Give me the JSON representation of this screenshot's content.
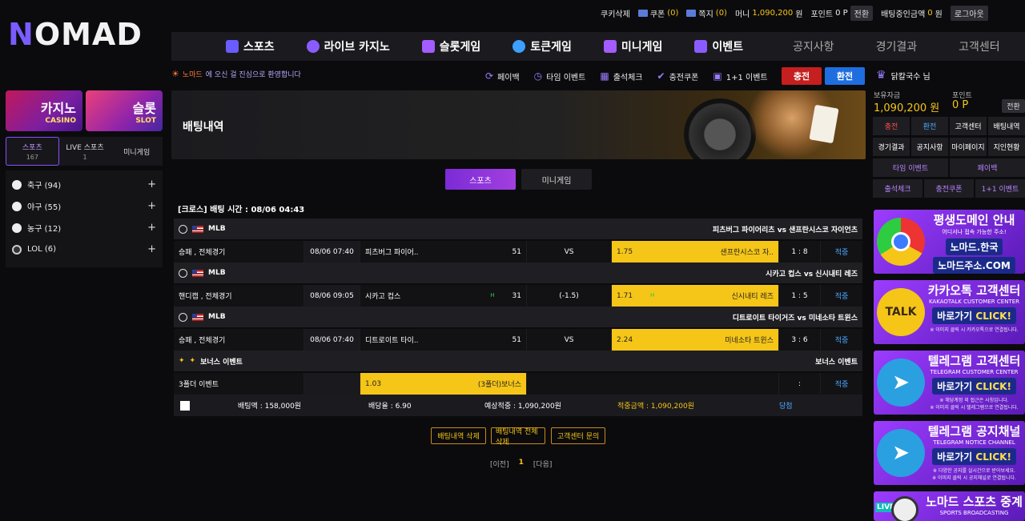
{
  "logo": {
    "text_n": "N",
    "text_rest": "OMAD"
  },
  "topbar": {
    "cookie": "쿠키삭제",
    "coupon_label": "쿠폰",
    "coupon_count": "(0)",
    "message_label": "쪽지",
    "message_count": "(0)",
    "money_label": "머니",
    "money_value": "1,090,200",
    "money_unit": "원",
    "point_label": "포인트",
    "point_value": "0 P",
    "convert": "전환",
    "betting_label": "배팅중인금액",
    "betting_value": "0",
    "betting_unit": "원",
    "logout": "로그아웃"
  },
  "nav": [
    {
      "label": "스포츠",
      "color": "#6a5cff"
    },
    {
      "label": "라이브 카지노",
      "color": "#8a5cff"
    },
    {
      "label": "슬롯게임",
      "color": "#a35cff"
    },
    {
      "label": "토큰게임",
      "color": "#3da0ff"
    },
    {
      "label": "미니게임",
      "color": "#a35cff"
    },
    {
      "label": "이벤트",
      "color": "#8a5cff"
    }
  ],
  "nav_plain": [
    "공지사항",
    "경기결과",
    "고객센터"
  ],
  "welcome": {
    "brand": "노마드",
    "text": "에 오신 걸 진심으로 환영합니다"
  },
  "quick": [
    "페이백",
    "타임 이벤트",
    "출석체크",
    "충전쿠폰",
    "1+1 이벤트"
  ],
  "charge_btn": "충전",
  "exchange_btn": "환전",
  "promos": {
    "casino": {
      "title": "카지노",
      "sub": "CASINO"
    },
    "slot": {
      "title": "슬롯",
      "sub": "SLOT"
    }
  },
  "sport_tabs": [
    {
      "label": "스포츠",
      "count": "167"
    },
    {
      "label": "LIVE 스포츠",
      "count": "1"
    },
    {
      "label": "미니게임",
      "count": ""
    }
  ],
  "sports": [
    {
      "label": "축구 (94)"
    },
    {
      "label": "야구 (55)"
    },
    {
      "label": "농구 (12)"
    },
    {
      "label": "LOL (6)"
    }
  ],
  "banner": {
    "title": "배팅내역"
  },
  "tabs": {
    "sports": "스포츠",
    "mini": "미니게임"
  },
  "bet_header": "[크로스] 배팅 시간 : 08/06 04:43",
  "games": [
    {
      "league": "MLB",
      "match": "피츠버그 파이어리츠 vs 샌프란시스코 자이언츠",
      "type": "승패 , 전체경기",
      "time": "08/06 07:40",
      "home": "피츠버그 파이어..",
      "home_odd": "51",
      "home_up": "",
      "vs": "VS",
      "away_odd": "1.75",
      "away_up": "",
      "away": "샌프란시스코 자..",
      "score": "1 : 8",
      "result": "적중"
    },
    {
      "league": "MLB",
      "match": "시카고 컵스 vs 신시내티 레즈",
      "type": "핸디캡 , 전체경기",
      "time": "08/06 09:05",
      "home": "시카고 컵스",
      "home_odd": "31",
      "home_up": "H",
      "vs": "(-1.5)",
      "away_odd": "1.71",
      "away_up": "H",
      "away": "신시내티 레즈",
      "score": "1 : 5",
      "result": "적중"
    },
    {
      "league": "MLB",
      "match": "디트로이트 타이거즈 vs 미네소타 트윈스",
      "type": "승패 , 전체경기",
      "time": "08/06 07:40",
      "home": "디트로이트 타이..",
      "home_odd": "51",
      "home_up": "",
      "vs": "VS",
      "away_odd": "2.24",
      "away_up": "",
      "away": "미네소타 트윈스",
      "score": "3 : 6",
      "result": "적중"
    }
  ],
  "bonus": {
    "league": "보너스 이벤트",
    "match": "보너스 이벤트",
    "type": "3폴더 이벤트",
    "odd": "1.03",
    "label": "(3폴더)보너스",
    "score": ":",
    "result": "적중"
  },
  "summary": {
    "bet_amount": "배팅액 : 158,000원",
    "odds": "배당율 : 6.90",
    "expected": "예상적중 : 1,090,200원",
    "won": "적중금액 : 1,090,200원",
    "status": "당첨"
  },
  "actions": [
    "배팅내역 삭제",
    "배팅내역 전체삭제",
    "고객센터 문의"
  ],
  "pager": {
    "prev": "[이전]",
    "current": "1",
    "next": "[다음]"
  },
  "user": {
    "name": "닭칼국수 님"
  },
  "balance": {
    "label": "보유자금",
    "value": "1,090,200 원"
  },
  "points": {
    "label": "포인트",
    "value": "0 P",
    "convert": "전환"
  },
  "right_buttons": [
    [
      "충전",
      "환전",
      "고객센터",
      "배팅내역"
    ],
    [
      "경기결과",
      "공지사항",
      "마이페이지",
      "지인현황"
    ],
    [
      "타임 이벤트",
      "페이백"
    ],
    [
      "출석체크",
      "충전쿠폰",
      "1+1 이벤트"
    ]
  ],
  "ads": [
    {
      "title": "평생도메인 안내",
      "sub": "어디서나 접속 가능한 주소!",
      "btn": "노마드.한국",
      "btn2": "노마드주소.COM",
      "note": "",
      "bg": "#7b2bd6",
      "circle": "#e33"
    },
    {
      "title": "카카오톡 고객센터",
      "sub": "KAKAOTALK CUSTOMER CENTER",
      "btn": "바로가기",
      "btn2": "CLICK!",
      "note": "※ 이미지 클릭 시 카카오톡으로 연결됩니다.",
      "bg": "#8a2be2",
      "circle": "#f5c518",
      "circle_text": "TALK"
    },
    {
      "title": "텔레그램 고객센터",
      "sub": "TELEGRAM CUSTOMER CENTER",
      "btn": "바로가기",
      "btn2": "CLICK!",
      "note": "※ 해당계정 외 접근은 사칭입니다.",
      "note2": "※ 이미지 클릭 시 텔레그램으로 연결됩니다.",
      "bg": "#7b2bd6",
      "circle": "#2aa0e0"
    },
    {
      "title": "텔레그램 공지채널",
      "sub": "TELEGRAM NOTICE CHANNEL",
      "btn": "바로가기",
      "btn2": "CLICK!",
      "note": "※ 다양한 공지를 실시간으로 받아보세요.",
      "note2": "※ 이미지 클릭 시 공지채널로 연결됩니다.",
      "bg": "#7b2bd6",
      "circle": "#2aa0e0"
    },
    {
      "title": "노마드 스포츠 중계",
      "sub": "SPORTS BROADCASTING",
      "btn": "",
      "btn2": "",
      "note": "",
      "bg": "#7b2bd6",
      "circle": "#eee",
      "circle_text": "LIVE"
    }
  ]
}
